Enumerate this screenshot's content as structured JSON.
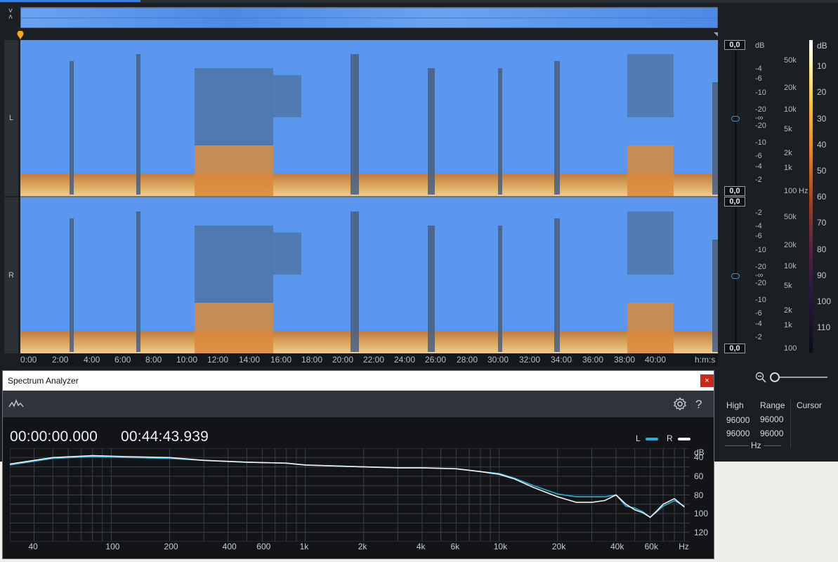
{
  "editor": {
    "channels": [
      {
        "label": "L"
      },
      {
        "label": "R"
      }
    ],
    "time_ruler": {
      "labels": [
        "0:00",
        "2:00",
        "4:00",
        "6:00",
        "8:00",
        "10:00",
        "12:00",
        "14:00",
        "16:00",
        "18:00",
        "20:00",
        "22:00",
        "24:00",
        "26:00",
        "28:00",
        "30:00",
        "32:00",
        "34:00",
        "36:00",
        "38:00",
        "40:00"
      ],
      "unit": "h:m:s"
    },
    "peak_readouts": [
      "0,0",
      "0,0",
      "0,0",
      "0,0"
    ],
    "db_scale": {
      "unit": "dB",
      "top_labels": [
        "-4",
        "-6",
        "-10",
        "-20",
        "-∞",
        "-20",
        "-10",
        "-6",
        "-4",
        "-2"
      ],
      "bottom_labels": [
        "-2",
        "-4",
        "-6",
        "-10",
        "-20",
        "-∞",
        "-20",
        "-10",
        "-6",
        "-4",
        "-2"
      ]
    },
    "hz_scale": {
      "unit": "Hz",
      "top_labels": [
        "50k",
        "20k",
        "10k",
        "5k",
        "2k",
        "1k",
        "100"
      ],
      "bottom_labels": [
        "50k",
        "20k",
        "10k",
        "5k",
        "2k",
        "1k",
        "100"
      ]
    },
    "colorbar": {
      "unit": "dB",
      "labels": [
        "10",
        "20",
        "30",
        "40",
        "50",
        "60",
        "70",
        "80",
        "90",
        "100",
        "110"
      ]
    },
    "info": {
      "headers": [
        "High",
        "Range",
        "Cursor"
      ],
      "rows": [
        [
          "96000",
          "96000"
        ],
        [
          "96000",
          "96000"
        ]
      ],
      "unit": "Hz"
    }
  },
  "spectrum_analyzer": {
    "title": "Spectrum Analyzer",
    "close_label": "×",
    "help_label": "?",
    "start_time": "00:00:00.000",
    "end_time": "00:44:43.939",
    "legend": [
      {
        "label": "L",
        "color": "#2fa9d8"
      },
      {
        "label": "R",
        "color": "#f2f2f2"
      }
    ],
    "chart_data": {
      "type": "line",
      "xscale": "log",
      "xlim": [
        30,
        96000
      ],
      "ylim": [
        130,
        30
      ],
      "ylabel": "dB",
      "xlabel": "Hz",
      "x_ticks": [
        "40",
        "100",
        "200",
        "400",
        "600",
        "1k",
        "2k",
        "4k",
        "6k",
        "10k",
        "20k",
        "40k",
        "60k",
        "Hz"
      ],
      "y_ticks": [
        "dB",
        "40",
        "60",
        "80",
        "100",
        "120"
      ],
      "series": [
        {
          "name": "L",
          "color": "#2fa9d8",
          "x": [
            30,
            50,
            80,
            120,
            200,
            300,
            500,
            800,
            1000,
            2000,
            3000,
            4000,
            6000,
            8000,
            10000,
            12000,
            15000,
            20000,
            25000,
            30000,
            35000,
            40000,
            45000,
            50000,
            55000,
            60000,
            65000,
            70000,
            80000,
            90000
          ],
          "y": [
            48,
            41,
            39,
            40,
            41,
            43,
            45,
            46,
            48,
            50,
            51,
            51,
            52,
            55,
            57,
            62,
            70,
            79,
            82,
            82,
            82,
            80,
            92,
            94,
            98,
            104,
            98,
            92,
            86,
            92
          ]
        },
        {
          "name": "R",
          "color": "#f2f2f2",
          "x": [
            30,
            50,
            80,
            120,
            200,
            300,
            500,
            800,
            1000,
            2000,
            3000,
            4000,
            6000,
            8000,
            10000,
            12000,
            15000,
            20000,
            25000,
            30000,
            35000,
            40000,
            45000,
            50000,
            55000,
            60000,
            65000,
            70000,
            80000,
            90000
          ],
          "y": [
            47,
            40,
            38,
            39,
            40,
            43,
            45,
            46,
            48,
            50,
            51,
            51,
            52,
            55,
            58,
            63,
            72,
            82,
            88,
            88,
            86,
            80,
            90,
            96,
            99,
            104,
            97,
            90,
            84,
            93
          ]
        }
      ]
    }
  }
}
